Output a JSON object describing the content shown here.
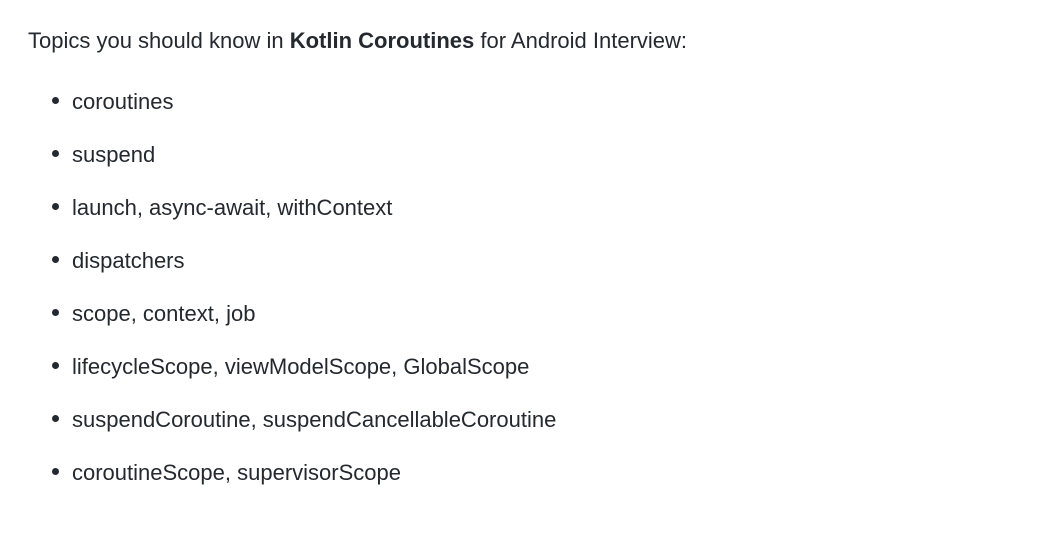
{
  "intro": {
    "prefix": "Topics you should know in ",
    "bold": "Kotlin Coroutines",
    "suffix": " for Android Interview:"
  },
  "topics": [
    "coroutines",
    "suspend",
    "launch, async-await, withContext",
    "dispatchers",
    "scope, context, job",
    "lifecycleScope, viewModelScope, GlobalScope",
    "suspendCoroutine, suspendCancellableCoroutine",
    "coroutineScope, supervisorScope"
  ]
}
